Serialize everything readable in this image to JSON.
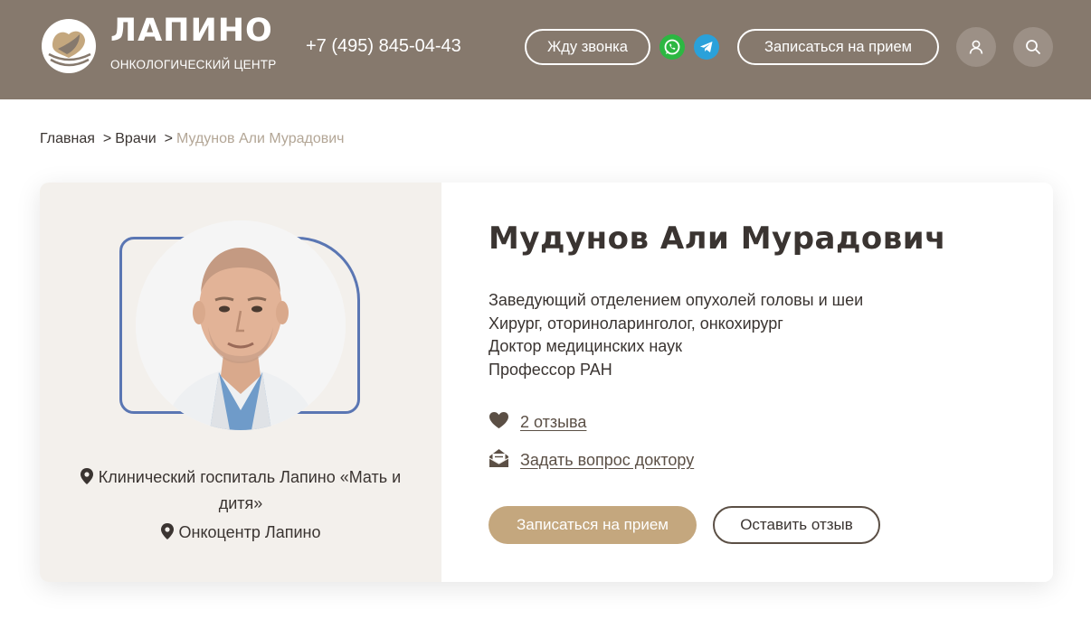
{
  "header": {
    "logo_title": "ЛАПИНО",
    "logo_subtitle": "ОНКОЛОГИЧЕСКИЙ ЦЕНТР",
    "phone": "+7 (495) 845-04-43",
    "callback_label": "Жду звонка",
    "appointment_label": "Записаться на прием",
    "icons": [
      "whatsapp-icon",
      "telegram-icon",
      "user-icon",
      "search-icon"
    ],
    "bg_color": "#86796d"
  },
  "breadcrumb": {
    "home": "Главная",
    "doctors": "Врачи",
    "current": "Мудунов Али Мурадович",
    "separator": ">"
  },
  "doctor": {
    "name": "Мудунов Али Мурадович",
    "positions": [
      "Заведующий отделением опухолей головы и шеи",
      "Хирург, оториноларинголог, онкохирург",
      "Доктор медицинских наук",
      "Профессор РАН"
    ],
    "locations": [
      "Клинический госпиталь Лапино «Мать и дитя»",
      "Онкоцентр Лапино"
    ],
    "reviews_link": "2 отзыва",
    "ask_link": "Задать вопрос доктору",
    "appointment_button": "Записаться на прием",
    "review_button": "Оставить отзыв",
    "accent_color": "#c4a77e",
    "frame_color": "#5a76b3"
  }
}
